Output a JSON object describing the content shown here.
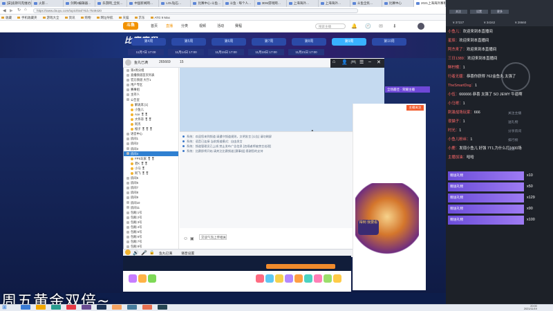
{
  "browser": {
    "tabs": [
      "[安]迪斯玛克维达的生活",
      "火影…",
      "剑网3编辑器…",
      "乐游网_全民…",
      "中国新闻网…",
      "LOL钻石…",
      "比赛中心-斗鱼…",
      "斗鱼 - 每个人…",
      "3DM游戏网…",
      "上海海外…",
      "上海海外…",
      "斗鱼全民…",
      "比赛中心",
      "2021上海海外赛事"
    ],
    "url": "https://www.douyu.com/topic/ttsvl?rid=7549420",
    "bookmarks": [
      "收藏",
      "手机收藏夹",
      "游戏大全",
      "资讯",
      "购物",
      "网址导航",
      "天猫",
      "京东",
      "ATG 9 Max"
    ]
  },
  "site": {
    "logo": "斗鱼",
    "nav": [
      "首页",
      "直播",
      "分类",
      "视频",
      "活动",
      "赛程"
    ],
    "search_placeholder": "搜索主播"
  },
  "banner": {
    "title": "比赛赛程",
    "schedule": [
      "第4周",
      "第5周",
      "第6周",
      "第7周",
      "第8周",
      "第9周",
      "第10周"
    ],
    "dates": [
      "11月7日 17:00",
      "11月14日 17:00",
      "11月15日 17:00",
      "11月18日 17:00",
      "11月21日 17:00"
    ],
    "score": "10"
  },
  "app": {
    "title_user": "鱼丸已满",
    "title_count": "265669",
    "title_extra": "15",
    "tree": [
      {
        "label": "第4周分组",
        "type": "folder"
      },
      {
        "label": "直播频道首页列表",
        "type": "folder"
      },
      {
        "label": "官方频道 大厅1",
        "type": "folder"
      },
      {
        "label": "用户专区",
        "type": "folder"
      },
      {
        "label": "赛事组",
        "type": "folder"
      },
      {
        "label": "主持人",
        "type": "folder"
      },
      {
        "label": "公告室",
        "type": "folder"
      },
      {
        "label": "解说席 [1]",
        "type": "user"
      },
      {
        "label": "小鱼儿",
        "type": "user"
      },
      {
        "label": "Ace  🎖🎖",
        "type": "user"
      },
      {
        "label": "大伟哥  🎖🎖",
        "type": "user"
      },
      {
        "label": "阿杰",
        "type": "user"
      },
      {
        "label": "橙子  🎖🎖🎖",
        "type": "user"
      },
      {
        "label": "语音中心",
        "type": "folder"
      },
      {
        "label": "房间1",
        "type": "folder"
      },
      {
        "label": "房间2",
        "type": "folder"
      },
      {
        "label": "房间3",
        "type": "folder"
      },
      {
        "label": "房间4",
        "type": "folder",
        "hl": true
      },
      {
        "label": "FPS玩家  🎖🎖",
        "type": "user"
      },
      {
        "label": "老K  🎖🎖",
        "type": "user"
      },
      {
        "label": "小马  🎖",
        "type": "user"
      },
      {
        "label": "阿飞  🎖🎖",
        "type": "user"
      },
      {
        "label": "房间5",
        "type": "folder"
      },
      {
        "label": "房间6",
        "type": "folder"
      },
      {
        "label": "房间7",
        "type": "folder"
      },
      {
        "label": "房间8",
        "type": "folder"
      },
      {
        "label": "房间9",
        "type": "folder"
      },
      {
        "label": "房间10",
        "type": "folder"
      },
      {
        "label": "房间11",
        "type": "folder"
      },
      {
        "label": "包厢 1号",
        "type": "folder"
      },
      {
        "label": "包厢 2号",
        "type": "folder"
      },
      {
        "label": "包厢 3号",
        "type": "folder"
      },
      {
        "label": "包厢 4号",
        "type": "folder"
      },
      {
        "label": "包厢 5号",
        "type": "folder"
      },
      {
        "label": "包厢 6号",
        "type": "folder"
      },
      {
        "label": "包厢 7号",
        "type": "folder"
      },
      {
        "label": "包厢 8号",
        "type": "folder"
      }
    ],
    "messages": [
      "系统：欢迎您来到频道 请遵守频道规则，文明发言 [公告] 请勿刷屏",
      "系统：语音已连接 当前频道模式：自由发言",
      "系统：频道管理员已上线 禁止发布广告信息 [违规者将被禁言处理]",
      "系统：比赛即将开始 请关注比赛频道 [赛事组] 感谢您的支持"
    ],
    "input_value": "交谈气泡上传相关",
    "bottom_user": "鱼丸已满",
    "bottom_extra": "语音设置"
  },
  "side_panel": {
    "rank_tag": "全场最佳 · 荣耀主播",
    "button": "主播关注",
    "badge": "得到 我要看"
  },
  "overlay": {
    "stats": [
      "¥ 37227",
      "¥ 34342",
      "¥ 28660"
    ],
    "buttons": [
      "关注",
      "设置",
      "更多"
    ],
    "danmaku": [
      {
        "name": "小鱼儿：",
        "text": "欢迎来到本直播间"
      },
      {
        "name": "星辰：",
        "text": "欢迎来到本直播间"
      },
      {
        "name": "阿杰来了：",
        "text": "欢迎来到本直播间"
      },
      {
        "name": "三日1389：",
        "text": "欢迎来到本直播间"
      },
      {
        "name": "鲜柠檬：",
        "text": "1"
      },
      {
        "name": "行者无疆：",
        "text": "恭喜你获得 762金鱼丸 太强了"
      },
      {
        "name": "TheSmartDog：",
        "text": "1"
      },
      {
        "name": "小伍：",
        "text": "666666 恭喜 太强了 SO JEWY 牛逼啊"
      },
      {
        "name": "小马哥：",
        "text": "1"
      },
      {
        "name": "刺激战场玩家：",
        "text": "666"
      },
      {
        "name": "夜猫子：",
        "text": "1"
      },
      {
        "name": "时光：",
        "text": "1"
      },
      {
        "name": "小鱼儿粉丝：",
        "text": "1"
      },
      {
        "name": "小鹿：",
        "text": "发现小鱼儿 好强 7T1,为什么打1000场"
      },
      {
        "name": "主播加油：",
        "text": "哈哈"
      }
    ],
    "side_labels": [
      "关注主播",
      "送礼物",
      "分享房间",
      "排行榜",
      "设置"
    ],
    "gifts": [
      {
        "user": "赠送礼物",
        "count": "x10"
      },
      {
        "user": "赠送礼物",
        "count": "x50"
      },
      {
        "user": "赠送礼物",
        "count": "x129"
      },
      {
        "user": "赠送礼物",
        "count": "x90"
      },
      {
        "user": "赠送礼物",
        "count": "x100"
      }
    ]
  },
  "caption": "周五黄金双倍~",
  "taskbar": {
    "time": "20:00",
    "date": "2021/11/19"
  },
  "colors": {
    "accent": "#f29200",
    "banner_active": "#38b2ff",
    "gift_purple": "#6e48d7",
    "danmaku_name": "#ff6a6a"
  }
}
